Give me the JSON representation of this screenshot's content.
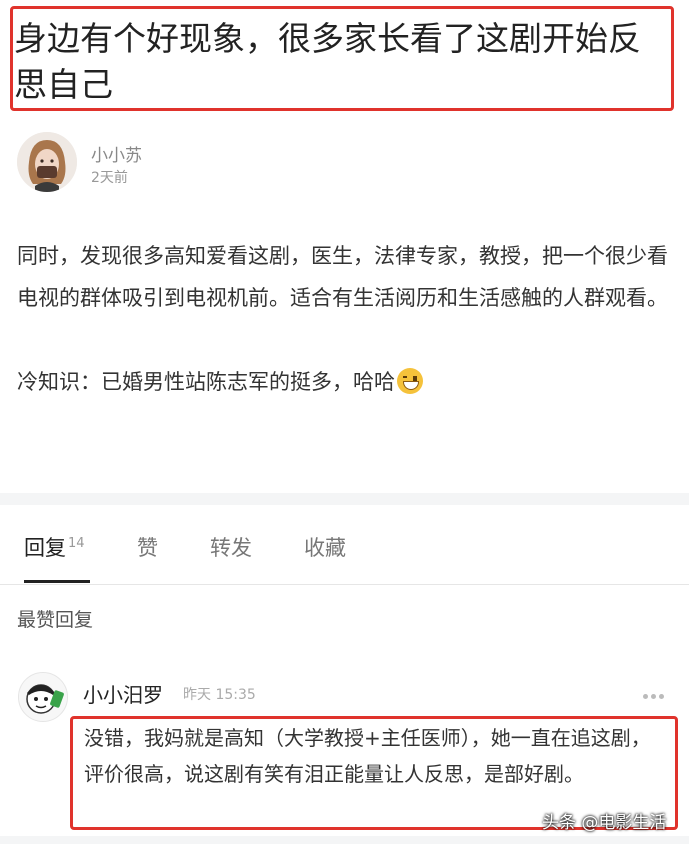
{
  "post": {
    "title": "身边有个好现象，很多家长看了这剧开始反思自己",
    "author": {
      "name": "小小苏",
      "time": "2天前"
    },
    "body": [
      "同时，发现很多高知爱看这剧，医生，法律专家，教授，把一个很少看电视的群体吸引到电视机前。适合有生活阅历和生活感触的人群观看。",
      "冷知识：已婚男性站陈志军的挺多，哈哈"
    ],
    "emoji": "grinning-face-emoji"
  },
  "tabs": [
    {
      "label": "回复",
      "count": "14"
    },
    {
      "label": "赞"
    },
    {
      "label": "转发"
    },
    {
      "label": "收藏"
    }
  ],
  "section_label": "最赞回复",
  "comment": {
    "author": "小小汨罗",
    "time": "昨天 15:35",
    "text": "没错，我妈就是高知（大学教授+主任医师），她一直在追这剧，评价很高，说这剧有笑有泪正能量让人反思，是部好剧。"
  },
  "watermark": "头条 @电影生活",
  "colors": {
    "highlight": "#e0332c",
    "text": "#333333",
    "muted": "#999999"
  }
}
